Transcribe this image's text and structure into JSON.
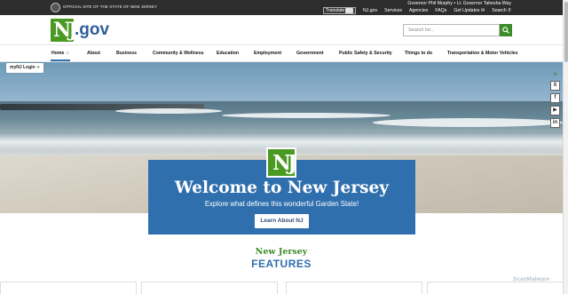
{
  "topbar": {
    "official": "OFFICIAL SITE OF THE STATE OF NEW JERSEY",
    "governor": "Governor Phil Murphy • Lt. Governor Tahesha Way",
    "translate": "Translate",
    "links": [
      "NJ.gov",
      "Services",
      "Agencies",
      "FAQs",
      "Get Updates",
      "Search"
    ]
  },
  "header": {
    "logo_text": ".gov",
    "search_placeholder": "Search for..."
  },
  "nav": {
    "items": [
      "Home",
      "About",
      "Business",
      "Community & Wellness",
      "Education",
      "Employment",
      "Government",
      "Public Safety & Security",
      "Things to do",
      "Transportation & Motor Vehicles"
    ]
  },
  "hero": {
    "mynj": "myNJ Login",
    "welcome_title": "Welcome to New Jersey",
    "welcome_sub": "Explore what defines this wonderful Garden State!",
    "welcome_btn": "Learn About NJ"
  },
  "features": {
    "pre": "New Jersey",
    "title": "FEATURES"
  },
  "social": [
    "x-icon",
    "facebook-icon",
    "youtube-icon",
    "linkedin-icon"
  ],
  "watermark": "ScanMalware",
  "colors": {
    "green": "#3d8a28",
    "blue": "#2f6fad",
    "dark": "#2d2d2d"
  }
}
